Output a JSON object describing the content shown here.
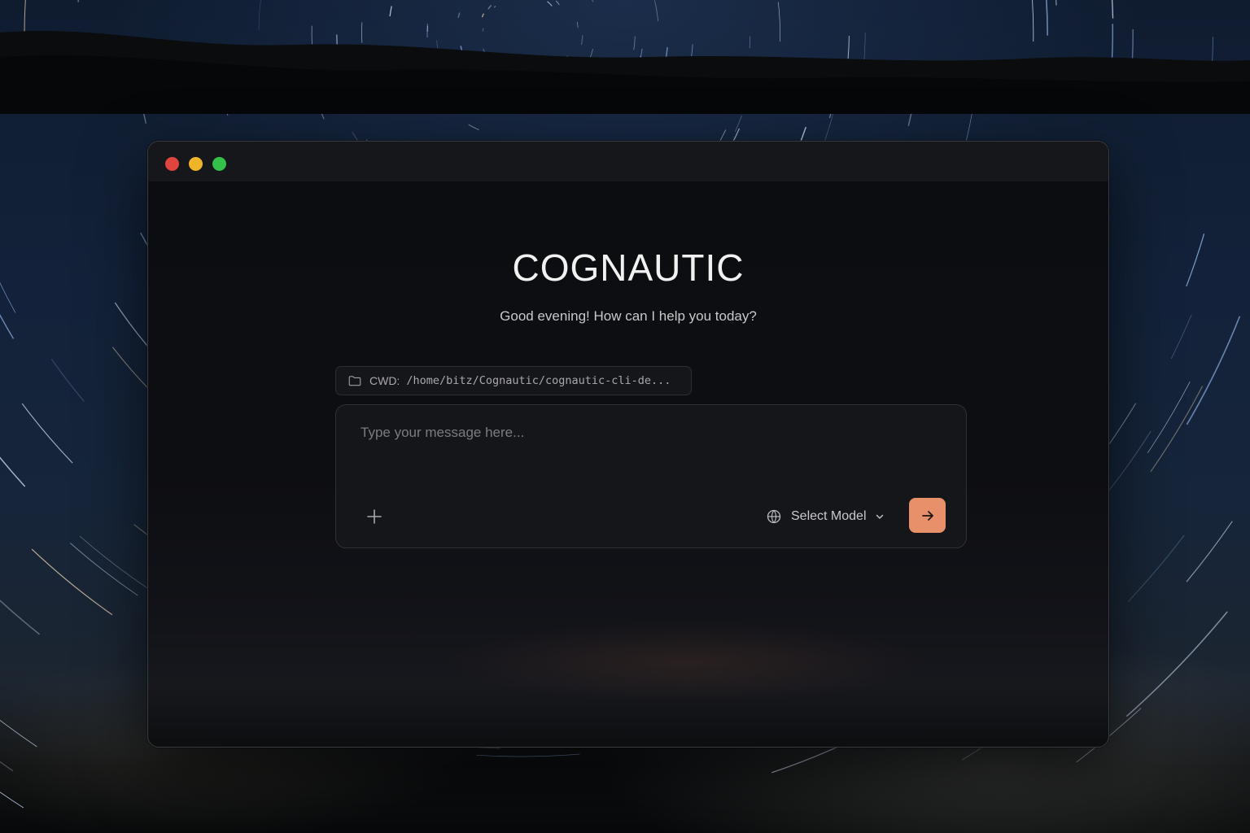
{
  "app": {
    "brand": "COGNAUTIC",
    "greeting": "Good evening! How can I help you today?"
  },
  "cwd": {
    "label": "CWD:",
    "path": "/home/bitz/Cognautic/cognautic-cli-de..."
  },
  "composer": {
    "placeholder": "Type your message here...",
    "value": "",
    "model_label": "Select Model"
  },
  "icons": {
    "cwd": "folder-icon",
    "attach": "plus-icon",
    "model": "globe-icon",
    "dropdown": "chevron-down-icon",
    "send": "arrow-right-icon"
  },
  "colors": {
    "accent": "#e8906a",
    "window_bg": "#0d0e12",
    "titlebar_bg": "#16171b",
    "close": "#e0443e",
    "minimize": "#f0b429",
    "maximize": "#34c14a"
  }
}
